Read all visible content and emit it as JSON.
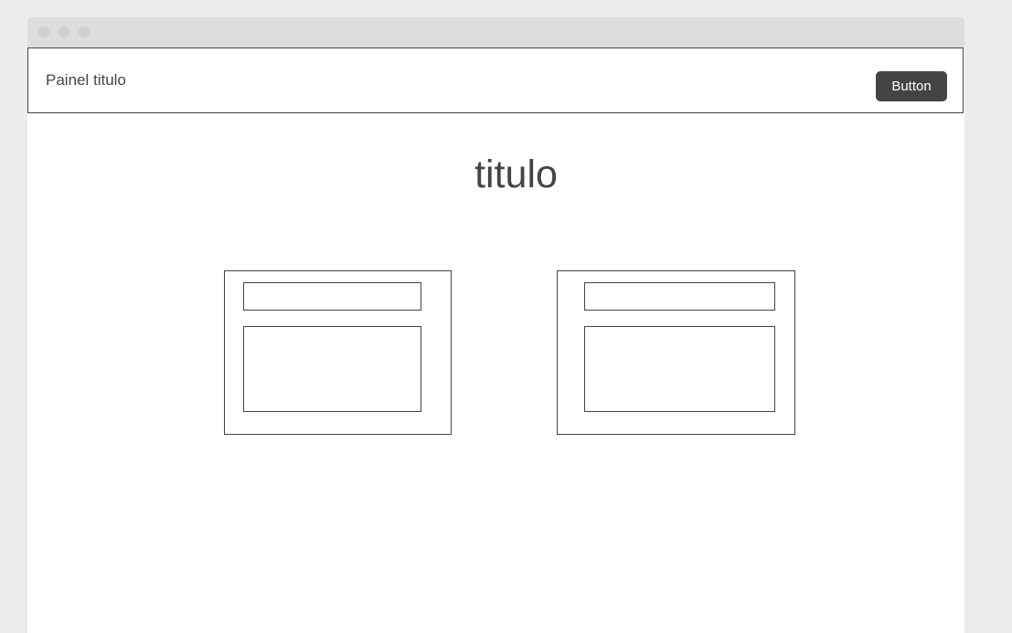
{
  "window": {
    "controls": [
      "close-dot",
      "minimize-dot",
      "maximize-dot"
    ]
  },
  "header": {
    "title": "Painel titulo",
    "button_label": "Button"
  },
  "main": {
    "heading": "titulo",
    "cards": [
      {
        "input_value": "",
        "textarea_value": ""
      },
      {
        "input_value": "",
        "textarea_value": ""
      }
    ]
  },
  "colors": {
    "background": "#ececec",
    "titlebar": "#dddddd",
    "window_dot": "#cfcfcf",
    "text": "#444444",
    "button_bg": "#444444",
    "button_text": "#ffffff"
  }
}
